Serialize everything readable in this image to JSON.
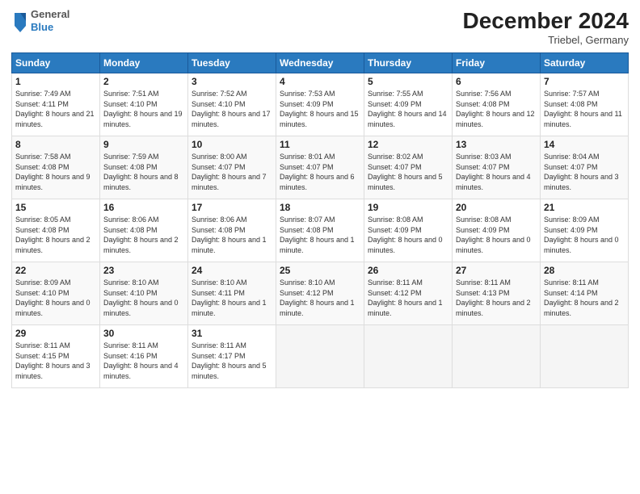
{
  "header": {
    "logo_general": "General",
    "logo_blue": "Blue",
    "month": "December 2024",
    "location": "Triebel, Germany"
  },
  "days_of_week": [
    "Sunday",
    "Monday",
    "Tuesday",
    "Wednesday",
    "Thursday",
    "Friday",
    "Saturday"
  ],
  "weeks": [
    [
      {
        "day": "1",
        "sunrise": "7:49 AM",
        "sunset": "4:11 PM",
        "daylight": "8 hours and 21 minutes."
      },
      {
        "day": "2",
        "sunrise": "7:51 AM",
        "sunset": "4:10 PM",
        "daylight": "8 hours and 19 minutes."
      },
      {
        "day": "3",
        "sunrise": "7:52 AM",
        "sunset": "4:10 PM",
        "daylight": "8 hours and 17 minutes."
      },
      {
        "day": "4",
        "sunrise": "7:53 AM",
        "sunset": "4:09 PM",
        "daylight": "8 hours and 15 minutes."
      },
      {
        "day": "5",
        "sunrise": "7:55 AM",
        "sunset": "4:09 PM",
        "daylight": "8 hours and 14 minutes."
      },
      {
        "day": "6",
        "sunrise": "7:56 AM",
        "sunset": "4:08 PM",
        "daylight": "8 hours and 12 minutes."
      },
      {
        "day": "7",
        "sunrise": "7:57 AM",
        "sunset": "4:08 PM",
        "daylight": "8 hours and 11 minutes."
      }
    ],
    [
      {
        "day": "8",
        "sunrise": "7:58 AM",
        "sunset": "4:08 PM",
        "daylight": "8 hours and 9 minutes."
      },
      {
        "day": "9",
        "sunrise": "7:59 AM",
        "sunset": "4:08 PM",
        "daylight": "8 hours and 8 minutes."
      },
      {
        "day": "10",
        "sunrise": "8:00 AM",
        "sunset": "4:07 PM",
        "daylight": "8 hours and 7 minutes."
      },
      {
        "day": "11",
        "sunrise": "8:01 AM",
        "sunset": "4:07 PM",
        "daylight": "8 hours and 6 minutes."
      },
      {
        "day": "12",
        "sunrise": "8:02 AM",
        "sunset": "4:07 PM",
        "daylight": "8 hours and 5 minutes."
      },
      {
        "day": "13",
        "sunrise": "8:03 AM",
        "sunset": "4:07 PM",
        "daylight": "8 hours and 4 minutes."
      },
      {
        "day": "14",
        "sunrise": "8:04 AM",
        "sunset": "4:07 PM",
        "daylight": "8 hours and 3 minutes."
      }
    ],
    [
      {
        "day": "15",
        "sunrise": "8:05 AM",
        "sunset": "4:08 PM",
        "daylight": "8 hours and 2 minutes."
      },
      {
        "day": "16",
        "sunrise": "8:06 AM",
        "sunset": "4:08 PM",
        "daylight": "8 hours and 2 minutes."
      },
      {
        "day": "17",
        "sunrise": "8:06 AM",
        "sunset": "4:08 PM",
        "daylight": "8 hours and 1 minute."
      },
      {
        "day": "18",
        "sunrise": "8:07 AM",
        "sunset": "4:08 PM",
        "daylight": "8 hours and 1 minute."
      },
      {
        "day": "19",
        "sunrise": "8:08 AM",
        "sunset": "4:09 PM",
        "daylight": "8 hours and 0 minutes."
      },
      {
        "day": "20",
        "sunrise": "8:08 AM",
        "sunset": "4:09 PM",
        "daylight": "8 hours and 0 minutes."
      },
      {
        "day": "21",
        "sunrise": "8:09 AM",
        "sunset": "4:09 PM",
        "daylight": "8 hours and 0 minutes."
      }
    ],
    [
      {
        "day": "22",
        "sunrise": "8:09 AM",
        "sunset": "4:10 PM",
        "daylight": "8 hours and 0 minutes."
      },
      {
        "day": "23",
        "sunrise": "8:10 AM",
        "sunset": "4:10 PM",
        "daylight": "8 hours and 0 minutes."
      },
      {
        "day": "24",
        "sunrise": "8:10 AM",
        "sunset": "4:11 PM",
        "daylight": "8 hours and 1 minute."
      },
      {
        "day": "25",
        "sunrise": "8:10 AM",
        "sunset": "4:12 PM",
        "daylight": "8 hours and 1 minute."
      },
      {
        "day": "26",
        "sunrise": "8:11 AM",
        "sunset": "4:12 PM",
        "daylight": "8 hours and 1 minute."
      },
      {
        "day": "27",
        "sunrise": "8:11 AM",
        "sunset": "4:13 PM",
        "daylight": "8 hours and 2 minutes."
      },
      {
        "day": "28",
        "sunrise": "8:11 AM",
        "sunset": "4:14 PM",
        "daylight": "8 hours and 2 minutes."
      }
    ],
    [
      {
        "day": "29",
        "sunrise": "8:11 AM",
        "sunset": "4:15 PM",
        "daylight": "8 hours and 3 minutes."
      },
      {
        "day": "30",
        "sunrise": "8:11 AM",
        "sunset": "4:16 PM",
        "daylight": "8 hours and 4 minutes."
      },
      {
        "day": "31",
        "sunrise": "8:11 AM",
        "sunset": "4:17 PM",
        "daylight": "8 hours and 5 minutes."
      },
      null,
      null,
      null,
      null
    ]
  ]
}
